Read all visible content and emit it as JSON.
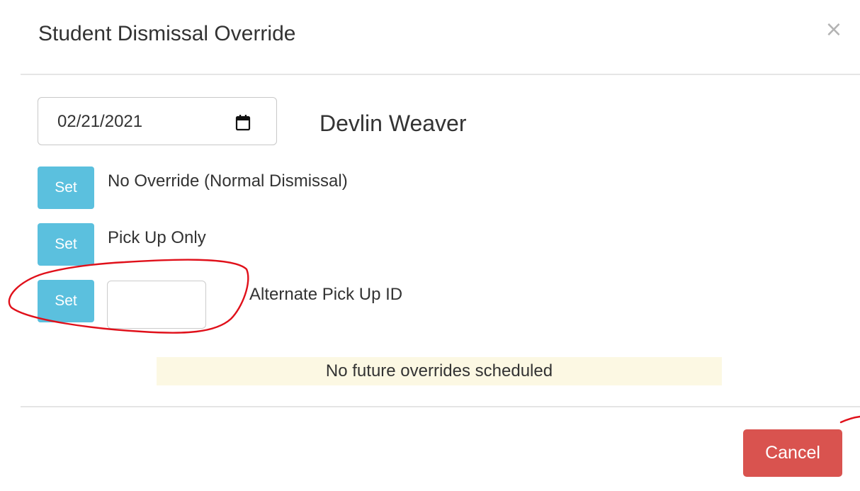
{
  "modal": {
    "title": "Student Dismissal Override",
    "close_symbol": "×"
  },
  "date_picker": {
    "value": "02/21/2021",
    "icon": "calendar-icon"
  },
  "student": {
    "name": "Devlin Weaver"
  },
  "options": [
    {
      "button_label": "Set",
      "label": "No Override (Normal Dismissal)"
    },
    {
      "button_label": "Set",
      "label": "Pick Up Only"
    },
    {
      "button_label": "Set",
      "label": "Alternate Pick Up ID",
      "input_value": ""
    }
  ],
  "notice": {
    "text": "No future overrides scheduled",
    "background": "#fcf8e3"
  },
  "footer": {
    "cancel_label": "Cancel"
  },
  "colors": {
    "set_button": "#5bc0de",
    "cancel_button": "#d9534f",
    "annotation": "#e0101a"
  }
}
